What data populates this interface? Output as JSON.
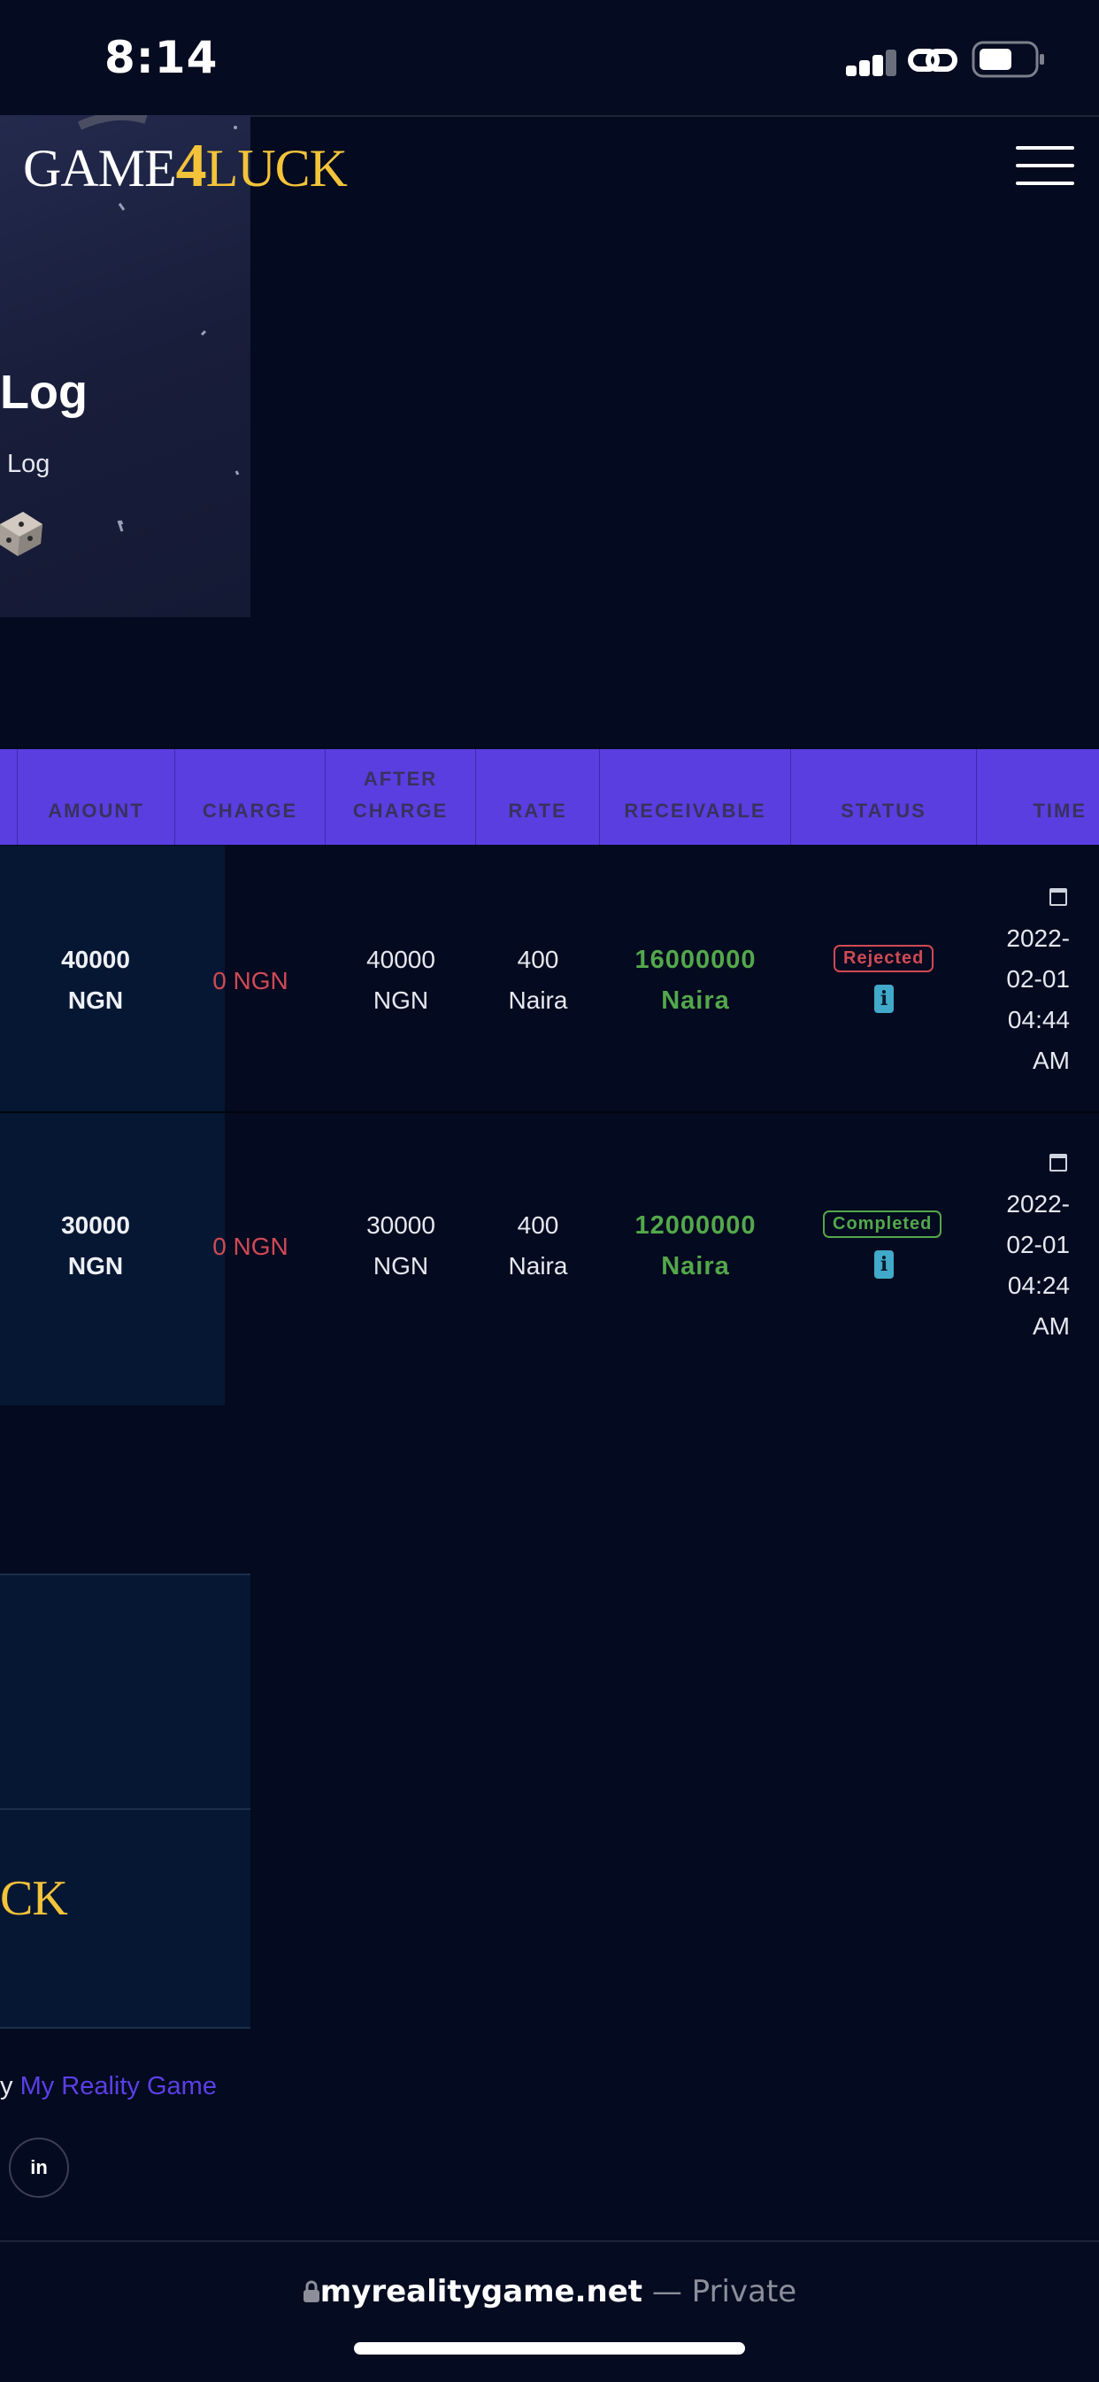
{
  "status_bar": {
    "time": "8:14"
  },
  "header": {
    "logo": {
      "part1": "GAME",
      "part2": "4",
      "part3": "LUCK"
    },
    "menu_icon": "hamburger-icon"
  },
  "hero": {
    "title": "Log",
    "breadcrumb": "Log"
  },
  "table": {
    "headers": [
      "AMOUNT",
      "CHARGE",
      "AFTER CHARGE",
      "RATE",
      "RECEIVABLE",
      "STATUS",
      "TIME"
    ],
    "rows": [
      {
        "amount": "40000 NGN",
        "charge": "0 NGN",
        "after_charge": "40000 NGN",
        "rate": "400 Naira",
        "receivable": "16000000 Naira",
        "status": "Rejected",
        "time": "2022-02-01 04:44 AM"
      },
      {
        "amount": "30000 NGN",
        "charge": "0 NGN",
        "after_charge": "30000 NGN",
        "rate": "400 Naira",
        "receivable": "12000000 Naira",
        "status": "Completed",
        "time": "2022-02-01 04:24 AM"
      }
    ]
  },
  "footer": {
    "logo_fragment": "CK",
    "credit_prefix": "y",
    "credit_link": "My Reality Game",
    "social": "in"
  },
  "browser": {
    "domain": "myrealitygame.net",
    "suffix": " — Private"
  },
  "colors": {
    "background": "#040a1f",
    "table_header": "#5a3ee0",
    "gold": "#f3c33a",
    "rejected": "#d04a55",
    "completed": "#53a84b",
    "info": "#41a9c9",
    "link": "#5b3fe6"
  }
}
